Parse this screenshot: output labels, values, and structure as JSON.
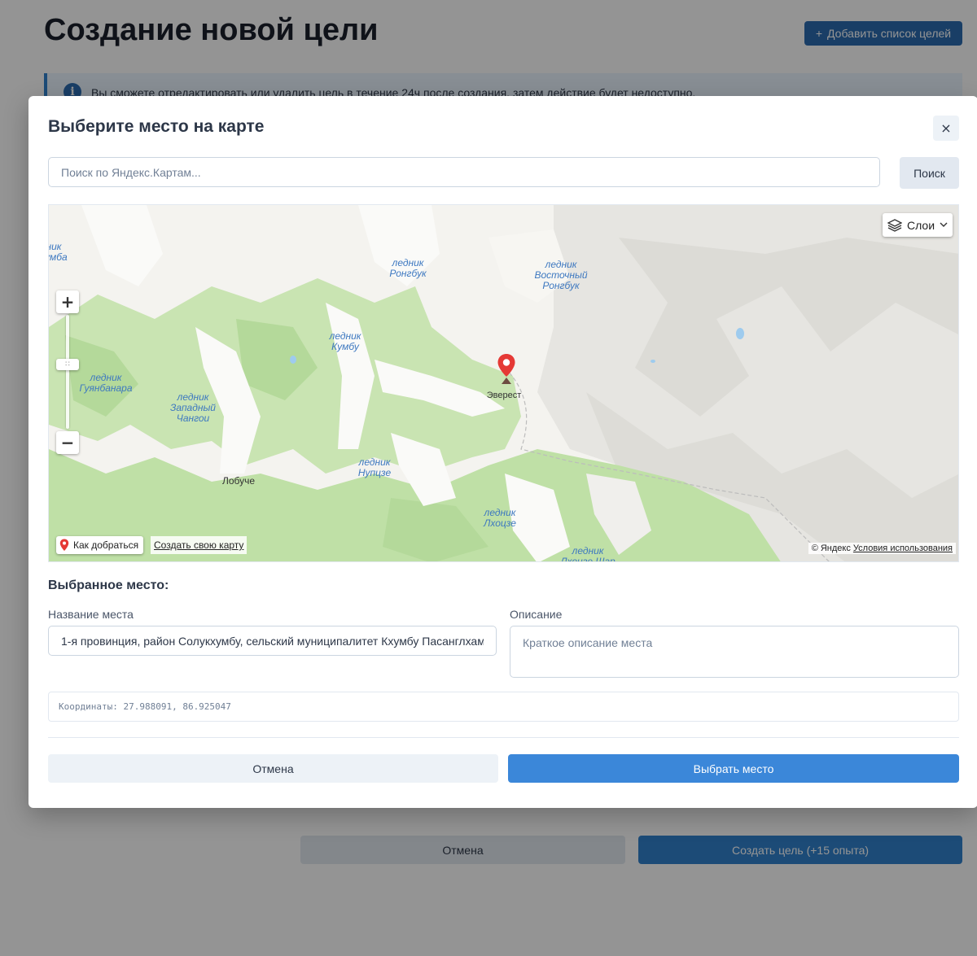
{
  "page": {
    "title": "Создание новой цели",
    "add_list_label": "Добавить список целей",
    "add_list_icon": "plus-icon",
    "info_text": "Вы сможете отредактировать или удалить цель в течение 24ч после создания, затем действие будет недоступно.",
    "info_icon": "info-icon",
    "cancel_label": "Отмена",
    "create_label": "Создать цель (+15 опыта)"
  },
  "modal": {
    "title": "Выберите место на карте",
    "close_label": "×",
    "search": {
      "placeholder": "Поиск по Яндекс.Картам...",
      "button_label": "Поиск"
    },
    "map": {
      "layers_label": "Слои",
      "layers_icon": "layers-icon",
      "zoom_in_label": "+",
      "zoom_out_label": "−",
      "route_label": "Как добраться",
      "create_map_label": "Создать свою карту",
      "copyright": "© Яндекс",
      "terms_label": "Условия использования",
      "marker_label": "Эверест",
      "labels": {
        "kumba_edge": "ник\nкумба",
        "rongbuk": "ледник\nРонгбук",
        "east_rongbuk": "ледник\nВосточный\nРонгбук",
        "khumbu": "ледник\nКумбу",
        "gyanbanara": "ледник\nГуянбанара",
        "west_changri": "ледник\nЗападный\nЧангои",
        "nuptse": "ледник\nНупцзе",
        "lobuche": "Лобуче",
        "lhotse": "ледник\nЛхоцзе",
        "lhotse_shar": "ледник\nЛхоцзе Шар"
      }
    },
    "selected": {
      "section_title": "Выбранное место:",
      "name_label": "Название места",
      "name_value": "1-я провинция, район Солукхумбу, сельский муниципалитет Кхумбу Пасанглхаму",
      "description_label": "Описание",
      "description_placeholder": "Краткое описание места",
      "coordinates_text": "Координаты: 27.988091, 86.925047"
    },
    "cancel_label": "Отмена",
    "select_label": "Выбрать место"
  },
  "colors": {
    "primary": "#3182ce",
    "primary_dark": "#2b6cb0",
    "pin": "#e53935",
    "forest": "#bfe0a6",
    "snow": "#fafaf8",
    "overlay": "rgba(0,0,0,0.42)"
  }
}
